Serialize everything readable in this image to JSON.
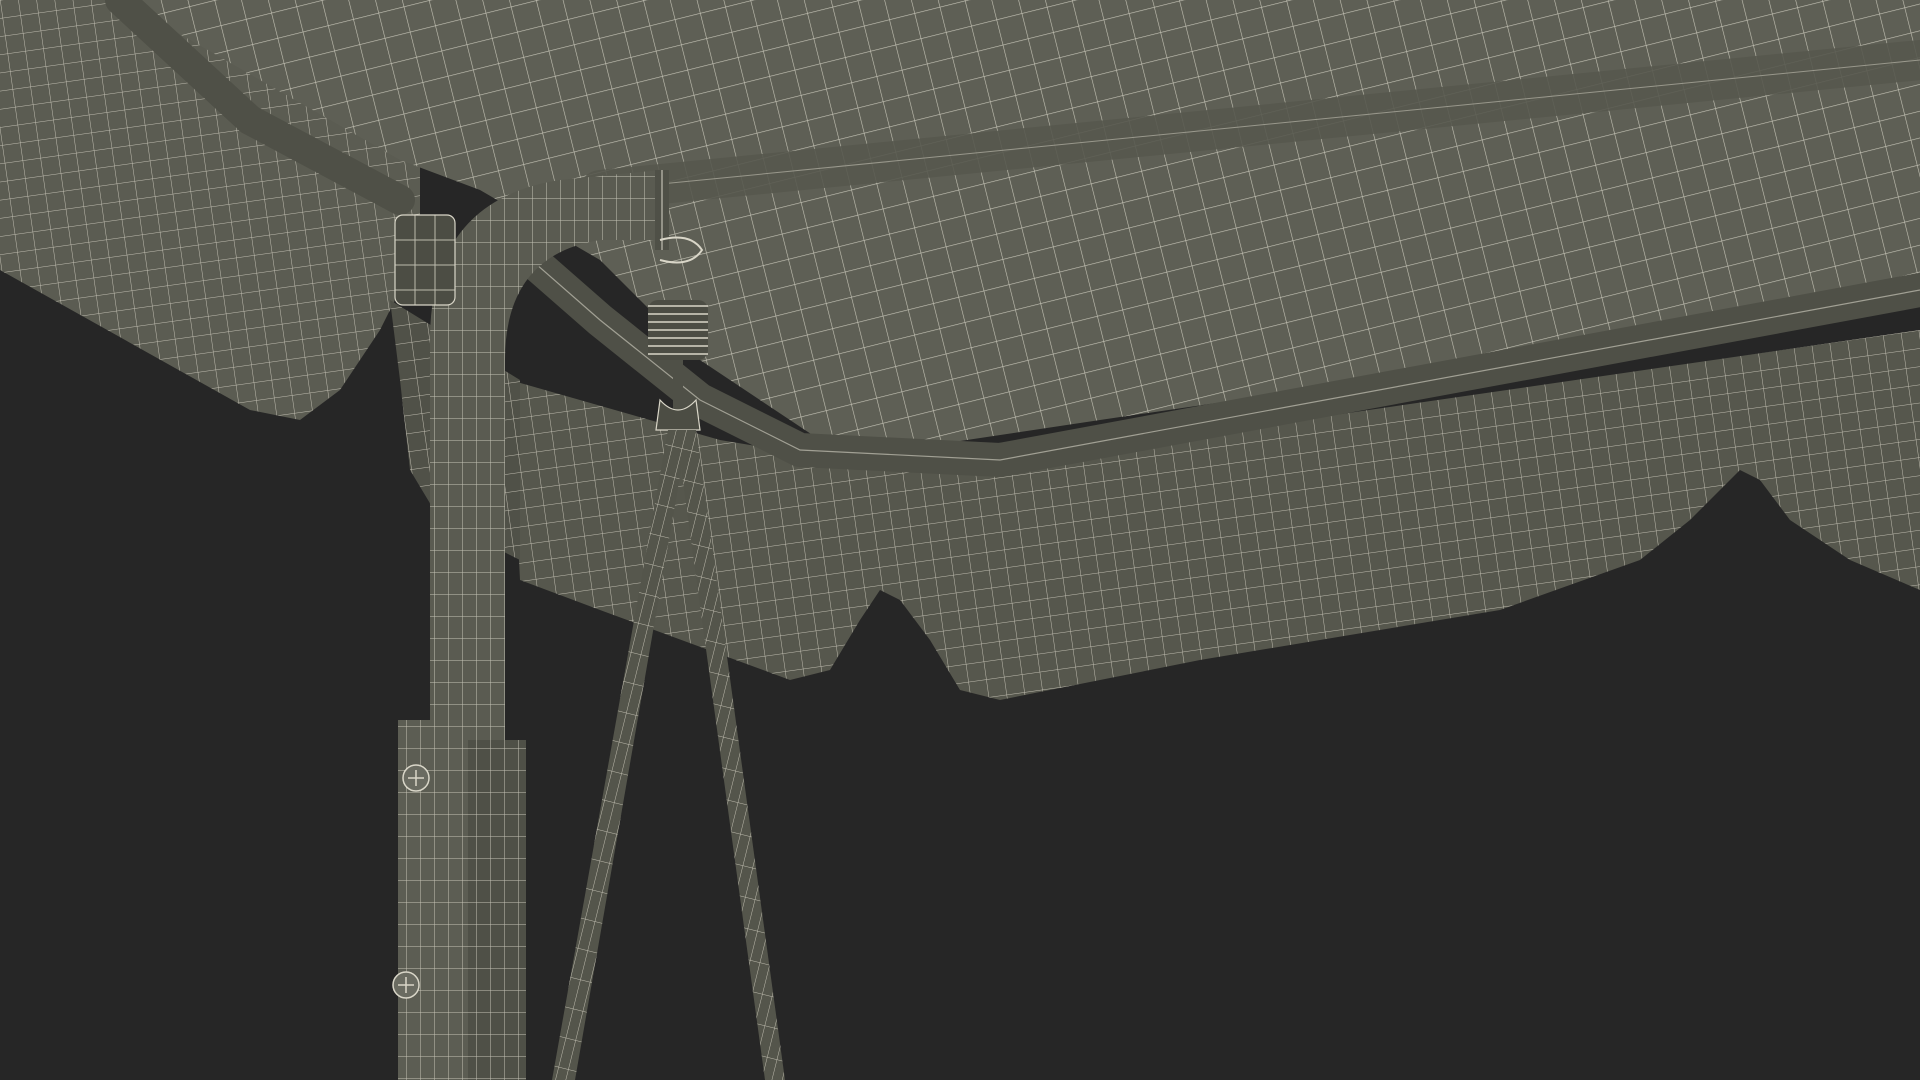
{
  "scene": {
    "background_color": "#262626",
    "surface_color": "#5b5c52",
    "surface_shade_color": "#4a4b42",
    "wire_color": "#d9d6c8",
    "subject": "wireframe-render"
  }
}
